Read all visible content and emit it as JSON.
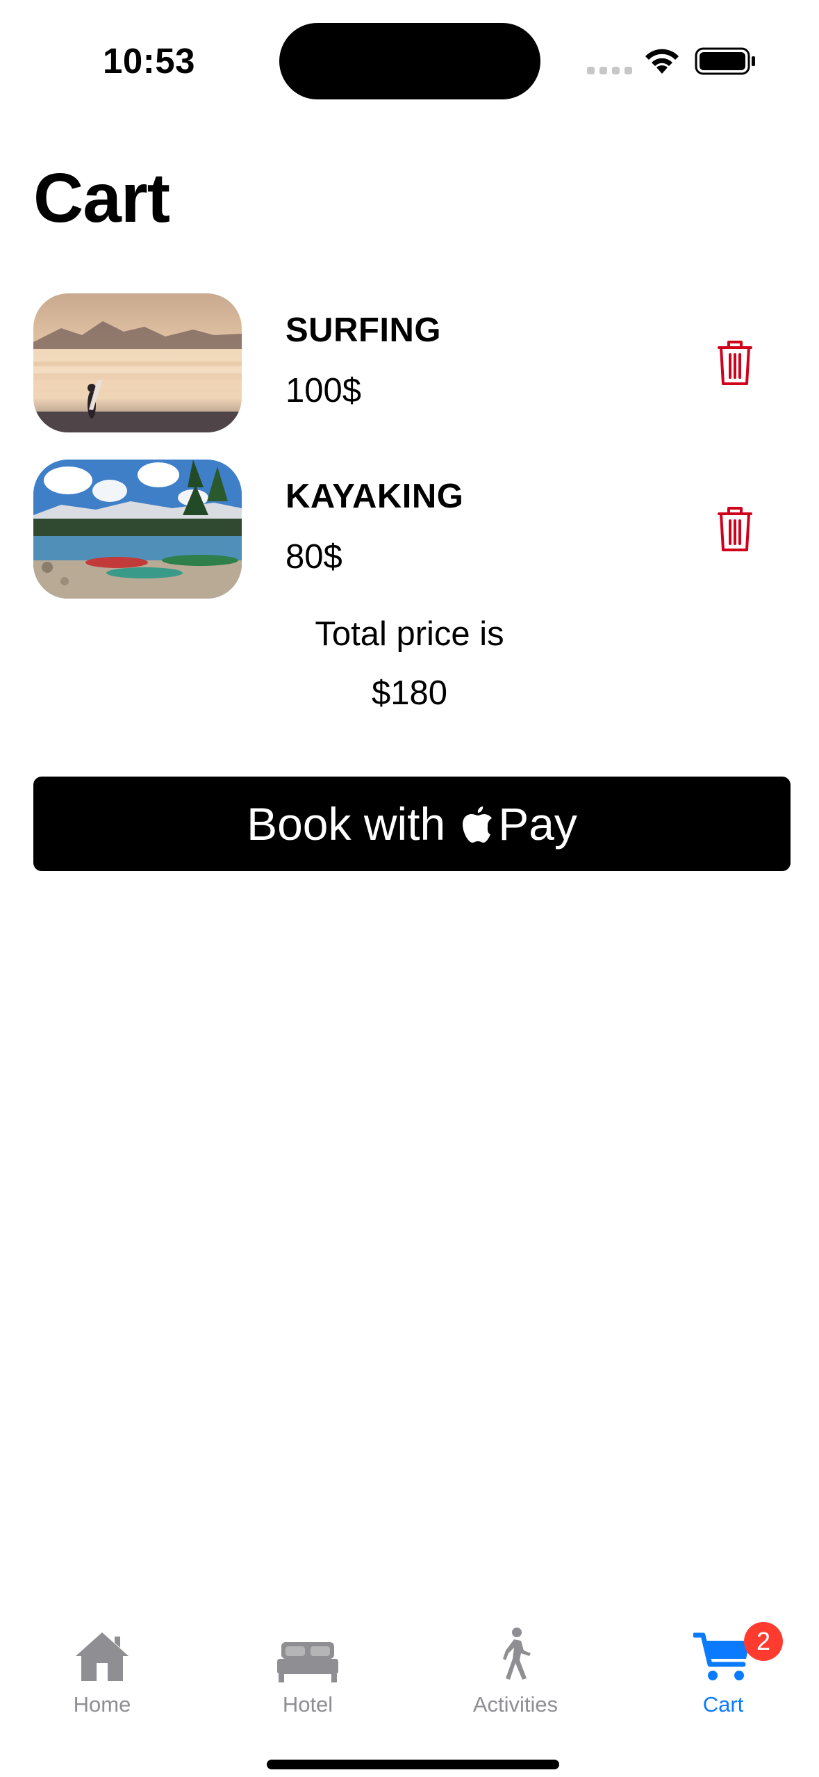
{
  "status_bar": {
    "time": "10:53"
  },
  "page": {
    "title": "Cart"
  },
  "cart": {
    "items": [
      {
        "name": "SURFING",
        "price": "100$",
        "image": "surfer-on-beach-at-sunset"
      },
      {
        "name": "KAYAKING",
        "price": "80$",
        "image": "kayaks-on-lake-shore"
      }
    ],
    "total_label": "Total price is",
    "total_value": "$180"
  },
  "pay_button": {
    "prefix": "Book with",
    "suffix": "Pay",
    "icon": "apple-icon"
  },
  "tab_bar": {
    "tabs": [
      {
        "label": "Home",
        "icon": "house-icon",
        "active": false
      },
      {
        "label": "Hotel",
        "icon": "bed-icon",
        "active": false
      },
      {
        "label": "Activities",
        "icon": "walking-figure-icon",
        "active": false
      },
      {
        "label": "Cart",
        "icon": "cart-icon",
        "active": true
      }
    ],
    "cart_badge": "2"
  },
  "colors": {
    "accent": "#0a7aff",
    "delete": "#d0021b",
    "badge": "#ff3b30",
    "inactive_tab": "#8e8e93"
  }
}
